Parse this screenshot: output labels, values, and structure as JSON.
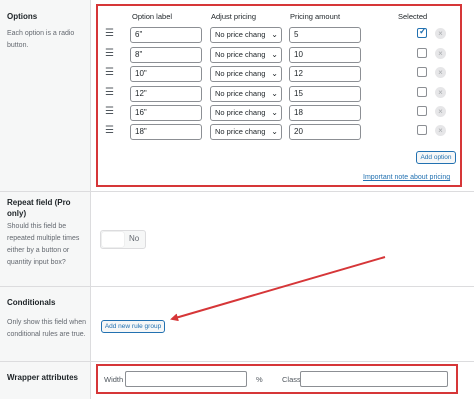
{
  "options": {
    "title": "Options",
    "description": "Each option is a radio button.",
    "headers": {
      "option_label": "Option label",
      "adjust_pricing": "Adjust pricing",
      "pricing_amount": "Pricing amount",
      "selected": "Selected"
    },
    "rows": [
      {
        "label": "6\"",
        "pricing": "No price chang",
        "amount": "5",
        "selected": true
      },
      {
        "label": "8\"",
        "pricing": "No price chang",
        "amount": "10",
        "selected": false
      },
      {
        "label": "10\"",
        "pricing": "No price chang",
        "amount": "12",
        "selected": false
      },
      {
        "label": "12\"",
        "pricing": "No price chang",
        "amount": "15",
        "selected": false
      },
      {
        "label": "16\"",
        "pricing": "No price chang",
        "amount": "18",
        "selected": false
      },
      {
        "label": "18\"",
        "pricing": "No price chang",
        "amount": "20",
        "selected": false
      }
    ],
    "add_option_label": "Add option",
    "important_note_label": "Important note about pricing"
  },
  "repeat_field": {
    "title": "Repeat field (Pro only)",
    "description": "Should this field be repeated multiple times either by a button or quantity input box?",
    "toggle_label": "No"
  },
  "conditionals": {
    "title": "Conditionals",
    "description": "Only show this field when conditional rules are true.",
    "add_rule_group_label": "Add new rule group"
  },
  "wrapper": {
    "title": "Wrapper attributes",
    "width_label": "Width",
    "width_value": "",
    "percent_symbol": "%",
    "class_label": "Class",
    "class_value": ""
  },
  "icons": {
    "drag": "drag-handle-icon",
    "remove": "remove-x-icon",
    "select_arrow": "chevron-down-icon"
  },
  "colors": {
    "highlight": "#d63638",
    "accent": "#2271b1",
    "panel_bg": "#f6f7f7"
  }
}
